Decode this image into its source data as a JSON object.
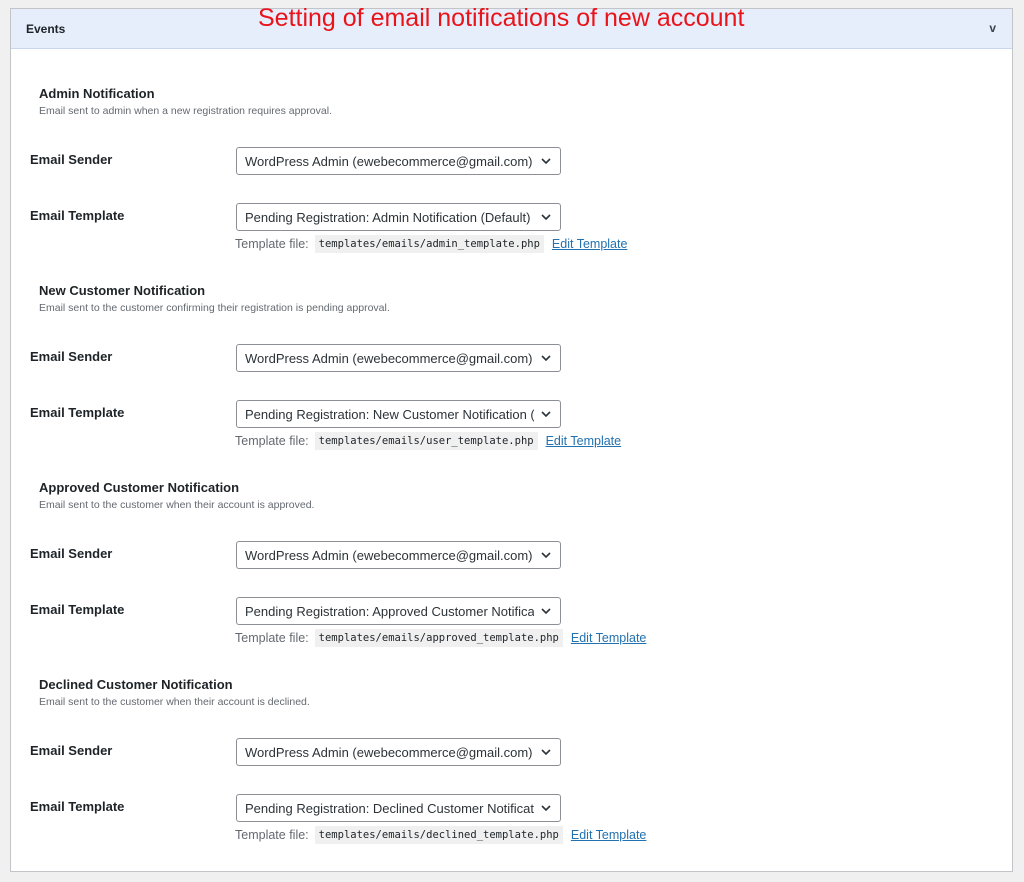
{
  "panel": {
    "title": "Events",
    "toggle": "v",
    "annotation": "Setting of email notifications of new account"
  },
  "sections": [
    {
      "title": "Admin Notification",
      "description": "Email sent to admin when a new registration requires approval.",
      "sender_label": "Email Sender",
      "sender_value": "WordPress Admin (ewebecommerce@gmail.com)",
      "template_label": "Email Template",
      "template_value": "Pending Registration: Admin Notification (Default)",
      "template_file_label": "Template file:",
      "template_file": "templates/emails/admin_template.php",
      "edit_link": "Edit Template"
    },
    {
      "title": "New Customer Notification",
      "description": "Email sent to the customer confirming their registration is pending approval.",
      "sender_label": "Email Sender",
      "sender_value": "WordPress Admin (ewebecommerce@gmail.com)",
      "template_label": "Email Template",
      "template_value": "Pending Registration: New Customer Notification (Default)",
      "template_file_label": "Template file:",
      "template_file": "templates/emails/user_template.php",
      "edit_link": "Edit Template"
    },
    {
      "title": "Approved Customer Notification",
      "description": "Email sent to the customer when their account is approved.",
      "sender_label": "Email Sender",
      "sender_value": "WordPress Admin (ewebecommerce@gmail.com)",
      "template_label": "Email Template",
      "template_value": "Pending Registration: Approved Customer Notification (Default)",
      "template_file_label": "Template file:",
      "template_file": "templates/emails/approved_template.php",
      "edit_link": "Edit Template"
    },
    {
      "title": "Declined Customer Notification",
      "description": "Email sent to the customer when their account is declined.",
      "sender_label": "Email Sender",
      "sender_value": "WordPress Admin (ewebecommerce@gmail.com)",
      "template_label": "Email Template",
      "template_value": "Pending Registration: Declined Customer Notification (Default)",
      "template_file_label": "Template file:",
      "template_file": "templates/emails/declined_template.php",
      "edit_link": "Edit Template"
    }
  ],
  "colors": {
    "header_bg": "#e7eefb",
    "annotation": "#e8141a",
    "link": "#2271b1"
  }
}
